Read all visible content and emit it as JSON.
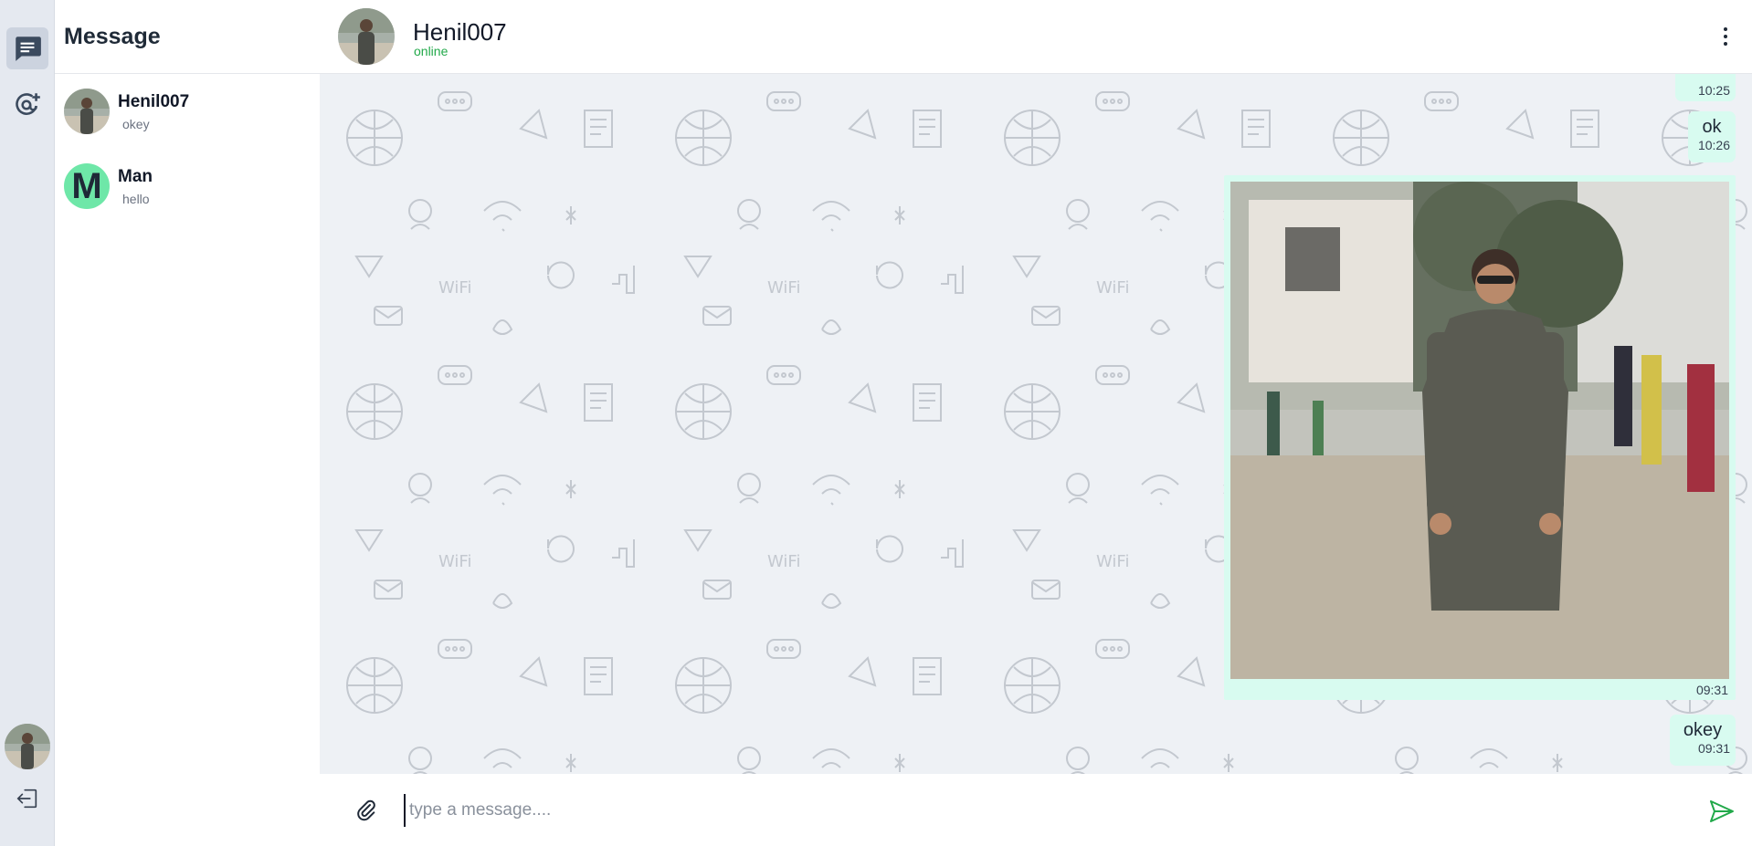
{
  "rail": {
    "items": [
      {
        "name": "messages",
        "icon": "chat-icon",
        "active": true
      },
      {
        "name": "contacts",
        "icon": "add-user-at-icon",
        "active": false
      }
    ],
    "logout_icon": "logout-icon"
  },
  "contacts": {
    "title": "Message",
    "list": [
      {
        "name": "Henil007",
        "last_message": "okey",
        "avatar": "photo"
      },
      {
        "name": "Man",
        "last_message": "hello",
        "avatar_letter": "M",
        "avatar_color": "#6ee7a8"
      }
    ]
  },
  "chat": {
    "name": "Henil007",
    "status": "online",
    "messages": [
      {
        "type": "text",
        "text": "",
        "time": "10:25"
      },
      {
        "type": "text",
        "text": "ok",
        "time": "10:26"
      },
      {
        "type": "image",
        "time": "09:31"
      },
      {
        "type": "text",
        "text": "okey",
        "time": "09:31"
      }
    ],
    "composer": {
      "placeholder": "type a message....",
      "value": ""
    }
  },
  "colors": {
    "accent_green": "#22a94a",
    "bubble": "#d8fbf0",
    "rail": "#e5e9f0",
    "chat_bg": "#eef1f5"
  }
}
